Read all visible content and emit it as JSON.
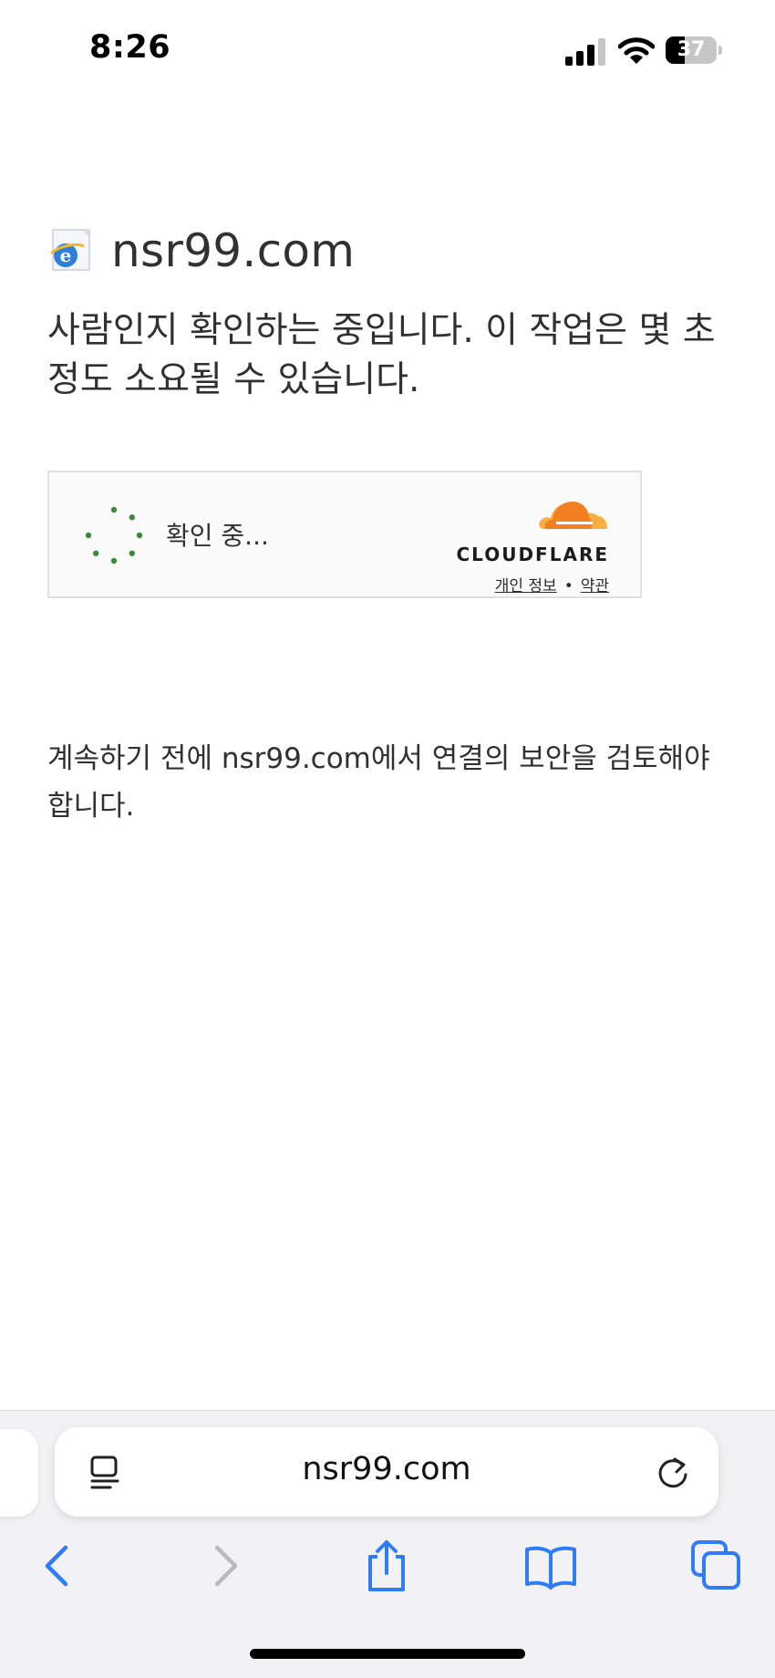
{
  "status_bar": {
    "time": "8:26",
    "battery_level": "37",
    "battery_fraction": 0.37
  },
  "page": {
    "site_name": "nsr99.com",
    "heading": "사람인지 확인하는 중입니다. 이 작업은 몇 초 정도 소요될 수 있습니다.",
    "challenge": {
      "status": "확인 중...",
      "brand": "CLOUDFLARE",
      "privacy_link": "개인 정보",
      "separator": "•",
      "terms_link": "약관"
    },
    "security_note": "계속하기 전에 nsr99.com에서 연결의 보안을 검토해야 합니다."
  },
  "browser": {
    "address": "nsr99.com",
    "icons": {
      "reader": "page-menu-icon",
      "reload": "reload-icon",
      "back": "back-chevron-icon",
      "forward": "forward-chevron-icon",
      "share": "share-icon",
      "bookmarks": "bookmarks-book-icon",
      "tabs": "tabs-icon"
    }
  },
  "colors": {
    "spinner": "#3a8a3e",
    "cloudflare_orange": "#f38020",
    "cloudflare_orange_light": "#faae40",
    "ios_blue": "#2f7cf6",
    "ios_disabled": "#b9b9be"
  }
}
